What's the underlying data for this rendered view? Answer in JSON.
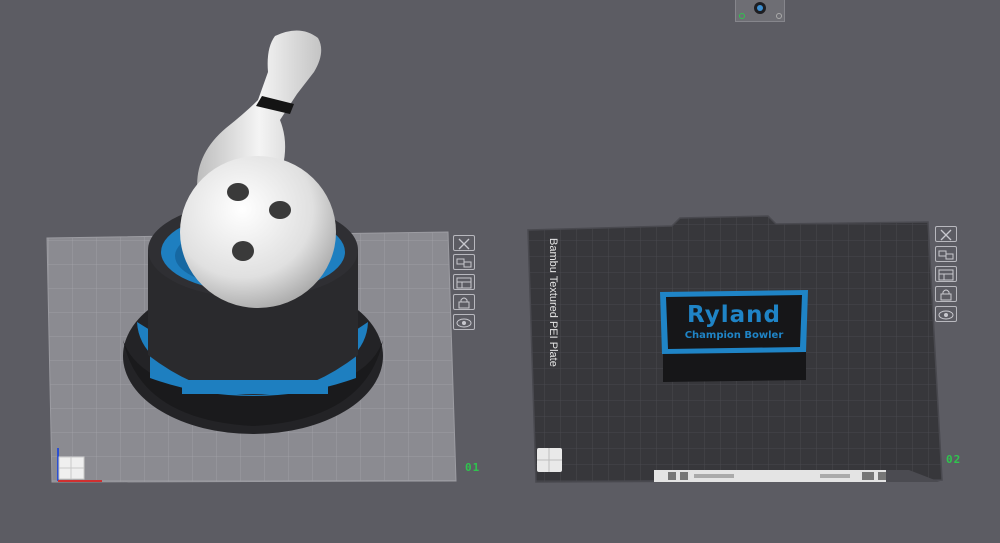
{
  "viewport": {
    "background": "#5c5c63"
  },
  "plates": [
    {
      "number": "01",
      "surface_color": "#8c8c92",
      "grid_color": "#a4a4aa",
      "active_number_color": "#2fc44e"
    },
    {
      "number": "02",
      "label": "Bambu Textured PEI Plate",
      "surface_color": "#38383c",
      "grid_color": "#4a4a50"
    }
  ],
  "models": {
    "trophy": {
      "body_color": "#2a2a2d",
      "accent_color": "#1e7fc0",
      "ball_color": "#e6e6e6"
    },
    "nameplate": {
      "title": "Ryland",
      "subtitle": "Champion Bowler",
      "text_color": "#1f84c6",
      "base_color": "#1a1a1c"
    }
  },
  "plate_tools": [
    {
      "name": "delete-plate-icon"
    },
    {
      "name": "arrange-plate-icon"
    },
    {
      "name": "plate-settings-icon"
    },
    {
      "name": "lock-plate-icon"
    },
    {
      "name": "view-plate-icon"
    }
  ]
}
